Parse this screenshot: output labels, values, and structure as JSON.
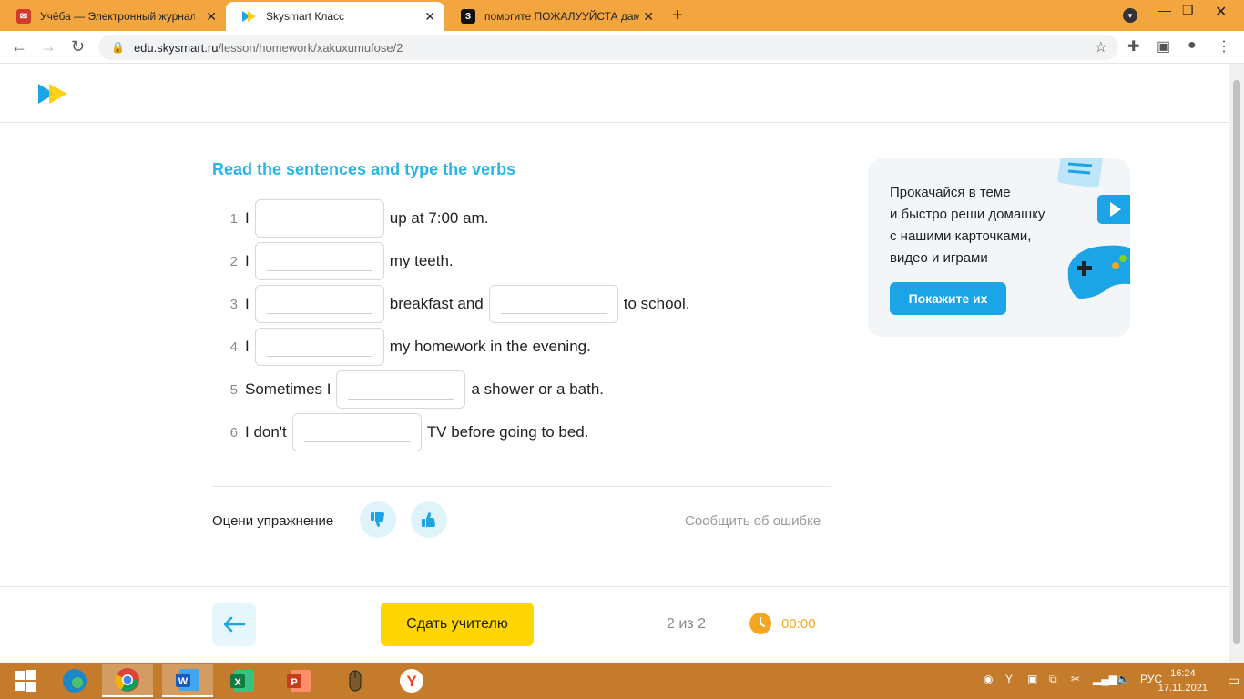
{
  "browser": {
    "tabs": [
      {
        "title": "Учёба — Электронный журнал",
        "favicon_color": "#d33a2c"
      },
      {
        "title": "Skysmart Класс",
        "favicon_color": "#ffffff"
      },
      {
        "title": "помогите ПОЖАЛУУЙСТА дам",
        "favicon_color": "#111111",
        "favicon_letter": "З"
      }
    ],
    "url_host": "edu.skysmart.ru",
    "url_path": "/lesson/homework/xakuxumufose/2"
  },
  "exercise": {
    "title": "Read the sentences and type the verbs",
    "rows": [
      {
        "num": "1",
        "before": "I",
        "after": "up at 7:00 am."
      },
      {
        "num": "2",
        "before": "I",
        "after": "my teeth."
      },
      {
        "num": "3",
        "before": "I",
        "middle": "breakfast and",
        "after": "to school."
      },
      {
        "num": "4",
        "before": "I",
        "after": "my homework in the evening."
      },
      {
        "num": "5",
        "before": "Sometimes I",
        "after": "a shower or a bath."
      },
      {
        "num": "6",
        "before": "I don't",
        "after": "TV before going to bed."
      }
    ],
    "rate_label": "Оцени упражнение",
    "report_label": "Сообщить об ошибке"
  },
  "promo": {
    "line1": "Прокачайся в теме",
    "line2": "и быстро реши домашку",
    "line3": "с нашими карточками,",
    "line4": "видео и играми",
    "button": "Покажите их"
  },
  "footer": {
    "submit": "Сдать учителю",
    "pager": "2 из 2",
    "timer": "00:00"
  },
  "taskbar": {
    "lang": "РУС",
    "time": "16:24",
    "date": "17.11.2021"
  },
  "colors": {
    "accent": "#25b5e9",
    "submit": "#ffd600",
    "timer": "#f5a623",
    "tabstrip": "#f3a640"
  }
}
